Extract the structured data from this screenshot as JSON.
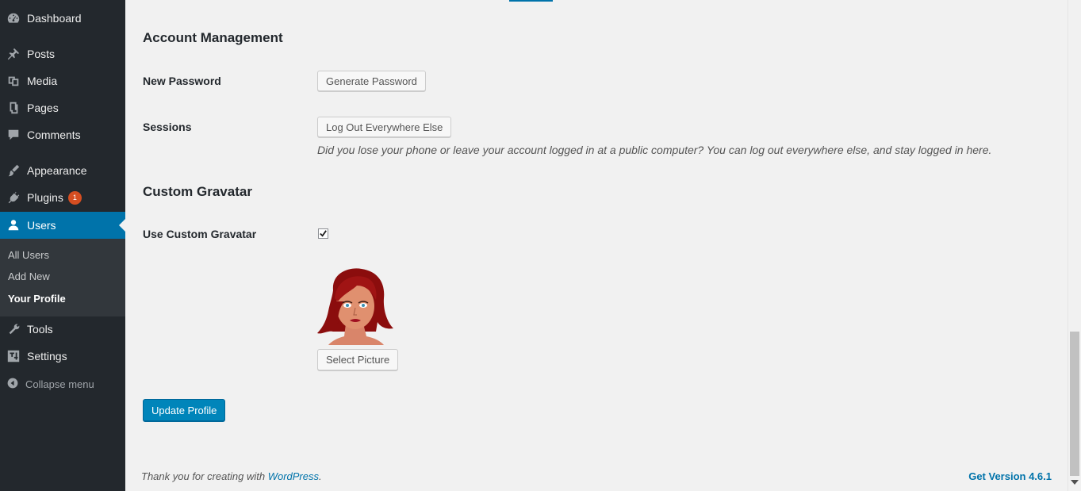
{
  "sidebar": {
    "items": [
      {
        "label": "Dashboard",
        "icon": "dashboard-icon"
      },
      {
        "label": "Posts",
        "icon": "pin-icon"
      },
      {
        "label": "Media",
        "icon": "media-icon"
      },
      {
        "label": "Pages",
        "icon": "pages-icon"
      },
      {
        "label": "Comments",
        "icon": "comment-icon"
      },
      {
        "label": "Appearance",
        "icon": "brush-icon"
      },
      {
        "label": "Plugins",
        "icon": "plug-icon",
        "badge": "1"
      },
      {
        "label": "Users",
        "icon": "user-icon",
        "current": true
      },
      {
        "label": "Tools",
        "icon": "wrench-icon"
      },
      {
        "label": "Settings",
        "icon": "settings-icon"
      }
    ],
    "submenu": [
      {
        "label": "All Users"
      },
      {
        "label": "Add New"
      },
      {
        "label": "Your Profile",
        "current": true
      }
    ],
    "collapse_label": "Collapse menu"
  },
  "account": {
    "title": "Account Management",
    "new_password_label": "New Password",
    "generate_password_button": "Generate Password",
    "sessions_label": "Sessions",
    "logout_everywhere_button": "Log Out Everywhere Else",
    "sessions_description": "Did you lose your phone or leave your account logged in at a public computer? You can log out everywhere else, and stay logged in here."
  },
  "gravatar": {
    "title": "Custom Gravatar",
    "use_label": "Use Custom Gravatar",
    "checked": true,
    "select_button": "Select Picture"
  },
  "update_button": "Update Profile",
  "footer": {
    "thanks_prefix": "Thank you for creating with ",
    "wordpress_link": "WordPress",
    "thanks_suffix": ".",
    "version_link": "Get Version 4.6.1"
  },
  "colors": {
    "sidebar_bg": "#23282d",
    "accent": "#0073aa",
    "badge": "#d54e21",
    "primary_button": "#0085ba"
  }
}
